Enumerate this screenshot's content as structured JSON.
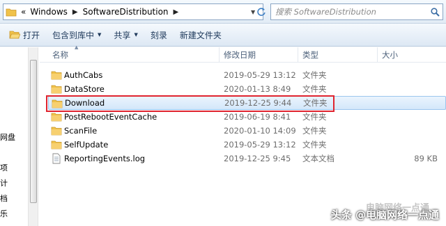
{
  "address": {
    "chevron": "«",
    "breadcrumbs": [
      "Windows",
      "SoftwareDistribution"
    ],
    "dropdown_icon": "chevron-down-icon",
    "refresh_icon": "refresh-icon"
  },
  "search": {
    "placeholder": "搜索 SoftwareDistribution",
    "icon": "search-icon"
  },
  "toolbar": {
    "open_label": "打开",
    "include_label": "包含到库中",
    "share_label": "共享",
    "burn_label": "刻录",
    "new_folder_label": "新建文件夹"
  },
  "navpane": {
    "labels": [
      "网盘",
      "项",
      "计",
      "档",
      "乐"
    ]
  },
  "columns": {
    "name": "名称",
    "date": "修改日期",
    "type": "类型",
    "size": "大小"
  },
  "files": [
    {
      "name": "AuthCabs",
      "date": "2019-05-29 13:12",
      "type": "文件夹",
      "size": "",
      "icon": "folder-icon"
    },
    {
      "name": "DataStore",
      "date": "2020-01-13 8:49",
      "type": "文件夹",
      "size": "",
      "icon": "folder-icon"
    },
    {
      "name": "Download",
      "date": "2019-12-25 9:44",
      "type": "文件夹",
      "size": "",
      "icon": "folder-icon",
      "selected": true
    },
    {
      "name": "PostRebootEventCache",
      "date": "2019-06-19 8:41",
      "type": "文件夹",
      "size": "",
      "icon": "folder-icon"
    },
    {
      "name": "ScanFile",
      "date": "2020-01-10 14:09",
      "type": "文件夹",
      "size": "",
      "icon": "folder-icon"
    },
    {
      "name": "SelfUpdate",
      "date": "2019-05-29 13:12",
      "type": "文件夹",
      "size": "",
      "icon": "folder-icon"
    },
    {
      "name": "ReportingEvents.log",
      "date": "2019-12-25 9:45",
      "type": "文本文档",
      "size": "89 KB",
      "icon": "text-file-icon"
    }
  ],
  "watermark": {
    "text": "头条 @电脑网络一点通",
    "ghost": "电脑网络一点通"
  },
  "colors": {
    "highlight": "#e0242f",
    "selection": "#d4e7fa",
    "folder": "#f0c24a"
  }
}
